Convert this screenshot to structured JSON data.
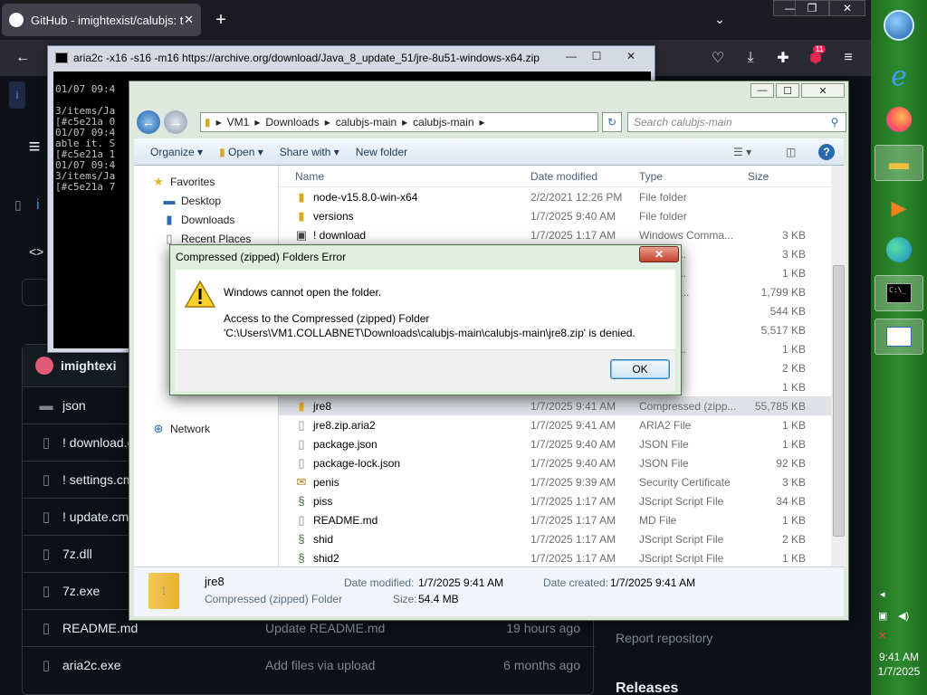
{
  "browser": {
    "tab_title": "GitHub - imightexist/calubjs: th",
    "badge": "11"
  },
  "github": {
    "repo_owner_prefix": "i",
    "owner": "imightexi",
    "files": [
      {
        "name": "json",
        "icon": "folder-icon",
        "commit": "",
        "date": ""
      },
      {
        "name": "! download.c",
        "icon": "file-icon",
        "commit": "",
        "date": ""
      },
      {
        "name": "! settings.cm",
        "icon": "file-icon",
        "commit": "",
        "date": ""
      },
      {
        "name": "! update.cm",
        "icon": "file-icon",
        "commit": "",
        "date": ""
      },
      {
        "name": "7z.dll",
        "icon": "file-icon",
        "commit": "",
        "date": ""
      },
      {
        "name": "7z.exe",
        "icon": "file-icon",
        "commit": "",
        "date": ""
      },
      {
        "name": "README.md",
        "icon": "file-icon",
        "commit": "Update README.md",
        "date": "19 hours ago"
      },
      {
        "name": "aria2c.exe",
        "icon": "file-icon",
        "commit": "Add files via upload",
        "date": "6 months ago"
      }
    ],
    "report": "Report repository",
    "releases": "Releases"
  },
  "console": {
    "title": "aria2c  -x16 -s16 -m16 https://archive.org/download/Java_8_update_51/jre-8u51-windows-x64.zip",
    "lines": "01/07 09:4\n\n3/items/Ja\n[#c5e21a 0\n01/07 09:4\nable it. S\n[#c5e21a 1\n01/07 09:4\n3/items/Ja\n[#c5e21a 7"
  },
  "explorer": {
    "breadcrumb": [
      "VM1",
      "Downloads",
      "calubjs-main",
      "calubjs-main"
    ],
    "search_placeholder": "Search calubjs-main",
    "commands": {
      "organize": "Organize",
      "open": "Open",
      "share": "Share with",
      "new_folder": "New folder"
    },
    "nav": {
      "favorites": "Favorites",
      "desktop": "Desktop",
      "downloads": "Downloads",
      "recent": "Recent Places",
      "network": "Network"
    },
    "columns": {
      "name": "Name",
      "date": "Date modified",
      "type": "Type",
      "size": "Size"
    },
    "rows": [
      {
        "name": "node-v15.8.0-win-x64",
        "date": "2/2/2021 12:26 PM",
        "type": "File folder",
        "size": "",
        "icon": "folder"
      },
      {
        "name": "versions",
        "date": "1/7/2025 9:40 AM",
        "type": "File folder",
        "size": "",
        "icon": "folder"
      },
      {
        "name": "! download",
        "date": "1/7/2025 1:17 AM",
        "type": "Windows Comma...",
        "size": "3 KB",
        "icon": "cmd"
      },
      {
        "name": "",
        "date": "",
        "type": "Comma...",
        "size": "3 KB",
        "icon": ""
      },
      {
        "name": "",
        "date": "",
        "type": "Comma...",
        "size": "1 KB",
        "icon": ""
      },
      {
        "name": "",
        "date": "",
        "type": "n extens...",
        "size": "1,799 KB",
        "icon": ""
      },
      {
        "name": "",
        "date": "",
        "type": "n",
        "size": "544 KB",
        "icon": ""
      },
      {
        "name": "",
        "date": "",
        "type": "n",
        "size": "5,517 KB",
        "icon": ""
      },
      {
        "name": "",
        "date": "",
        "type": "Comma...",
        "size": "1 KB",
        "icon": ""
      },
      {
        "name": "",
        "date": "",
        "type": "cript File",
        "size": "2 KB",
        "icon": ""
      },
      {
        "name": "",
        "date": "",
        "type": "cript File",
        "size": "1 KB",
        "icon": ""
      },
      {
        "name": "jre8",
        "date": "1/7/2025 9:41 AM",
        "type": "Compressed (zipp...",
        "size": "55,785 KB",
        "icon": "zip",
        "selected": true
      },
      {
        "name": "jre8.zip.aria2",
        "date": "1/7/2025 9:41 AM",
        "type": "ARIA2 File",
        "size": "1 KB",
        "icon": "file"
      },
      {
        "name": "package.json",
        "date": "1/7/2025 9:40 AM",
        "type": "JSON File",
        "size": "1 KB",
        "icon": "file"
      },
      {
        "name": "package-lock.json",
        "date": "1/7/2025 9:40 AM",
        "type": "JSON File",
        "size": "92 KB",
        "icon": "file"
      },
      {
        "name": "penis",
        "date": "1/7/2025 9:39 AM",
        "type": "Security Certificate",
        "size": "3 KB",
        "icon": "cert"
      },
      {
        "name": "piss",
        "date": "1/7/2025 1:17 AM",
        "type": "JScript Script File",
        "size": "34 KB",
        "icon": "script"
      },
      {
        "name": "README.md",
        "date": "1/7/2025 1:17 AM",
        "type": "MD File",
        "size": "1 KB",
        "icon": "file"
      },
      {
        "name": "shid",
        "date": "1/7/2025 1:17 AM",
        "type": "JScript Script File",
        "size": "2 KB",
        "icon": "script"
      },
      {
        "name": "shid2",
        "date": "1/7/2025 1:17 AM",
        "type": "JScript Script File",
        "size": "1 KB",
        "icon": "script"
      }
    ],
    "details": {
      "name": "jre8",
      "type": "Compressed (zipped) Folder",
      "modified_label": "Date modified:",
      "modified": "1/7/2025 9:41 AM",
      "created_label": "Date created:",
      "created": "1/7/2025 9:41 AM",
      "size_label": "Size:",
      "size": "54.4 MB"
    }
  },
  "dialog": {
    "title": "Compressed (zipped) Folders Error",
    "line1": "Windows cannot open the folder.",
    "line2": "Access to the Compressed (zipped) Folder",
    "line3": "'C:\\Users\\VM1.COLLABNET\\Downloads\\calubjs-main\\calubjs-main\\jre8.zip' is denied.",
    "ok": "OK"
  },
  "taskbar": {
    "time": "9:41 AM",
    "date": "1/7/2025"
  },
  "colors": {
    "taskbar": "#2e8a2e",
    "github_bg": "#0d1117",
    "explorer_frame": "#dfe8df"
  }
}
